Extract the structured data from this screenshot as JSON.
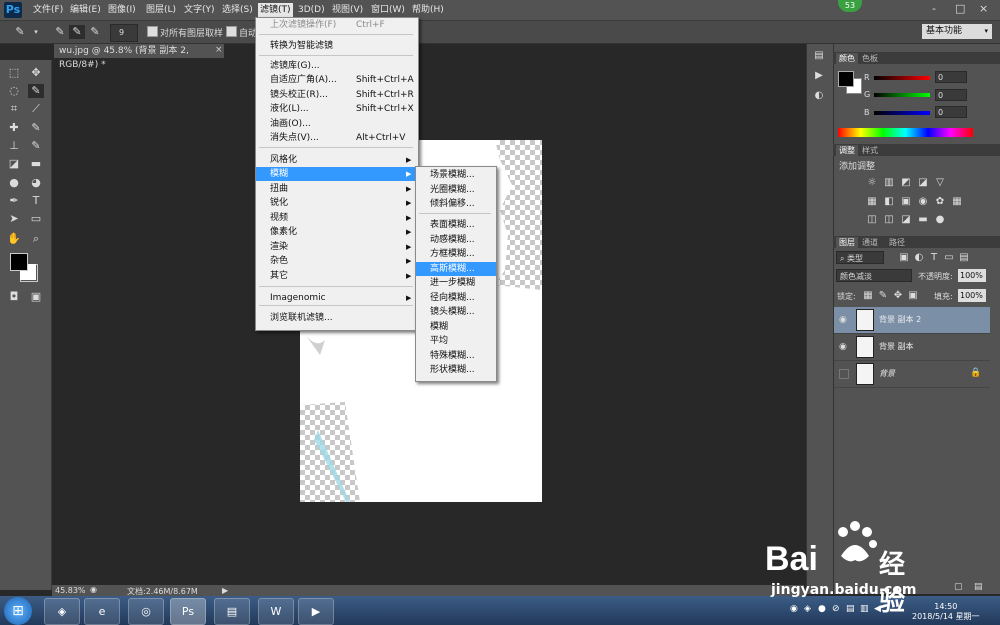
{
  "app": {
    "logo": "Ps"
  },
  "menubar": {
    "items": [
      "文件(F)",
      "编辑(E)",
      "图像(I)",
      "图层(L)",
      "文字(Y)",
      "选择(S)",
      "滤镜(T)",
      "3D(D)",
      "视图(V)",
      "窗口(W)",
      "帮助(H)"
    ],
    "active_index": 6,
    "user_badge": "53",
    "win_controls": [
      "-",
      "□",
      "×"
    ]
  },
  "options_bar": {
    "brush_size": "9",
    "sample_all_layers": "对所有图层取样",
    "auto_enhance": "自动",
    "workspace": "基本功能"
  },
  "document": {
    "tab_title": "wu.jpg @ 45.8% (背景 副本 2, RGB/8#) *",
    "close": "×"
  },
  "status": {
    "zoom": "45.83%",
    "doc_info": "文档:2.46M/8.67M"
  },
  "filter_menu": {
    "items": [
      {
        "label": "上次滤镜操作(F)",
        "shortcut": "Ctrl+F",
        "disabled": true
      },
      {
        "label": "转换为智能滤镜"
      },
      {
        "label": "滤镜库(G)..."
      },
      {
        "label": "自适应广角(A)...",
        "shortcut": "Shift+Ctrl+A"
      },
      {
        "label": "镜头校正(R)...",
        "shortcut": "Shift+Ctrl+R"
      },
      {
        "label": "液化(L)...",
        "shortcut": "Shift+Ctrl+X"
      },
      {
        "label": "油画(O)..."
      },
      {
        "label": "消失点(V)...",
        "shortcut": "Alt+Ctrl+V"
      },
      {
        "label": "风格化",
        "submenu": true
      },
      {
        "label": "模糊",
        "submenu": true,
        "highlighted": true
      },
      {
        "label": "扭曲",
        "submenu": true
      },
      {
        "label": "锐化",
        "submenu": true
      },
      {
        "label": "视频",
        "submenu": true
      },
      {
        "label": "像素化",
        "submenu": true
      },
      {
        "label": "渲染",
        "submenu": true
      },
      {
        "label": "杂色",
        "submenu": true
      },
      {
        "label": "其它",
        "submenu": true
      },
      {
        "label": "Imagenomic",
        "submenu": true
      },
      {
        "label": "浏览联机滤镜..."
      }
    ],
    "arrow": "▶"
  },
  "blur_menu": {
    "items": [
      "场景模糊...",
      "光圈模糊...",
      "倾斜偏移...",
      "表面模糊...",
      "动感模糊...",
      "方框模糊...",
      "高斯模糊...",
      "进一步模糊",
      "径向模糊...",
      "镜头模糊...",
      "模糊",
      "平均",
      "特殊模糊...",
      "形状模糊..."
    ],
    "highlight_index": 6
  },
  "color_panel": {
    "tabs": [
      "颜色",
      "色板"
    ],
    "channels": [
      {
        "label": "R",
        "value": "0"
      },
      {
        "label": "G",
        "value": "0"
      },
      {
        "label": "B",
        "value": "0"
      }
    ],
    "foreground": "#000000",
    "background": "#ffffff"
  },
  "adjust_panel": {
    "tabs": [
      "调整",
      "样式"
    ],
    "title": "添加调整"
  },
  "layers_panel": {
    "tabs": [
      "图层",
      "通道",
      "路径"
    ],
    "filter_kind": "类型",
    "blend_mode": "颜色减淡",
    "opacity_label": "不透明度:",
    "opacity": "100%",
    "lock_label": "锁定:",
    "fill_label": "填充:",
    "fill": "100%",
    "layers": [
      {
        "name": "背景 副本 2",
        "selected": true
      },
      {
        "name": "背景 副本",
        "selected": false
      },
      {
        "name": "背景",
        "selected": false,
        "locked": true
      }
    ]
  },
  "taskbar": {
    "time": "14:50",
    "date": "2018/5/14 星期一"
  },
  "watermark": {
    "brand": "Bai",
    "brand2": "经验",
    "url": "jingyan.baidu.com"
  }
}
